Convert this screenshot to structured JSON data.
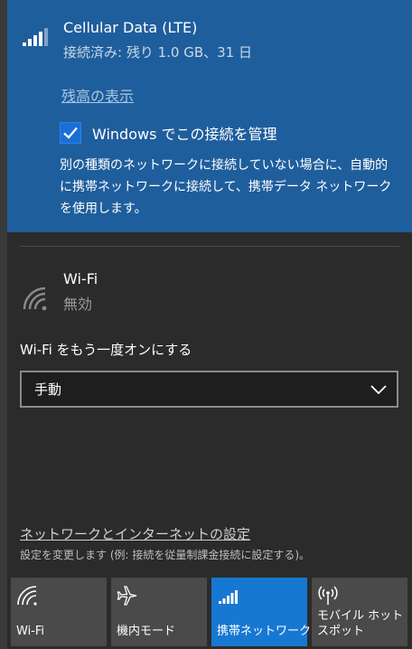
{
  "colors": {
    "panel_bg": "#2b2b2b",
    "selected_bg": "#1f5e9c",
    "accent": "#1778d2",
    "tile_bg": "#4a4a4a"
  },
  "cellular": {
    "name": "Cellular Data (LTE)",
    "status": "接続済み: 残り 1.0 GB、31 日",
    "balance_link": "残高の表示",
    "manage_label": "Windows でこの接続を管理",
    "manage_checked": true,
    "manage_description": "別の種類のネットワークに接続していない場合に、自動的に携帯ネットワークに接続して、携帯データ ネットワークを使用します。",
    "icon": "signal-bars-icon"
  },
  "wifi": {
    "name": "Wi-Fi",
    "status": "無効",
    "turn_on_label": "Wi-Fi をもう一度オンにする",
    "turn_on_selected": "手動",
    "icon": "wifi-icon"
  },
  "settings": {
    "link": "ネットワークとインターネットの設定",
    "description": "設定を変更します (例: 接続を従量制課金接続に設定する)。"
  },
  "tiles": [
    {
      "label": "Wi-Fi",
      "icon": "wifi-icon",
      "active": false
    },
    {
      "label": "機内モード",
      "icon": "airplane-icon",
      "active": false
    },
    {
      "label": "携帯ネットワーク",
      "icon": "signal-bars-icon",
      "active": true
    },
    {
      "label": "モバイル ホットスポット",
      "icon": "hotspot-icon",
      "active": false
    }
  ]
}
